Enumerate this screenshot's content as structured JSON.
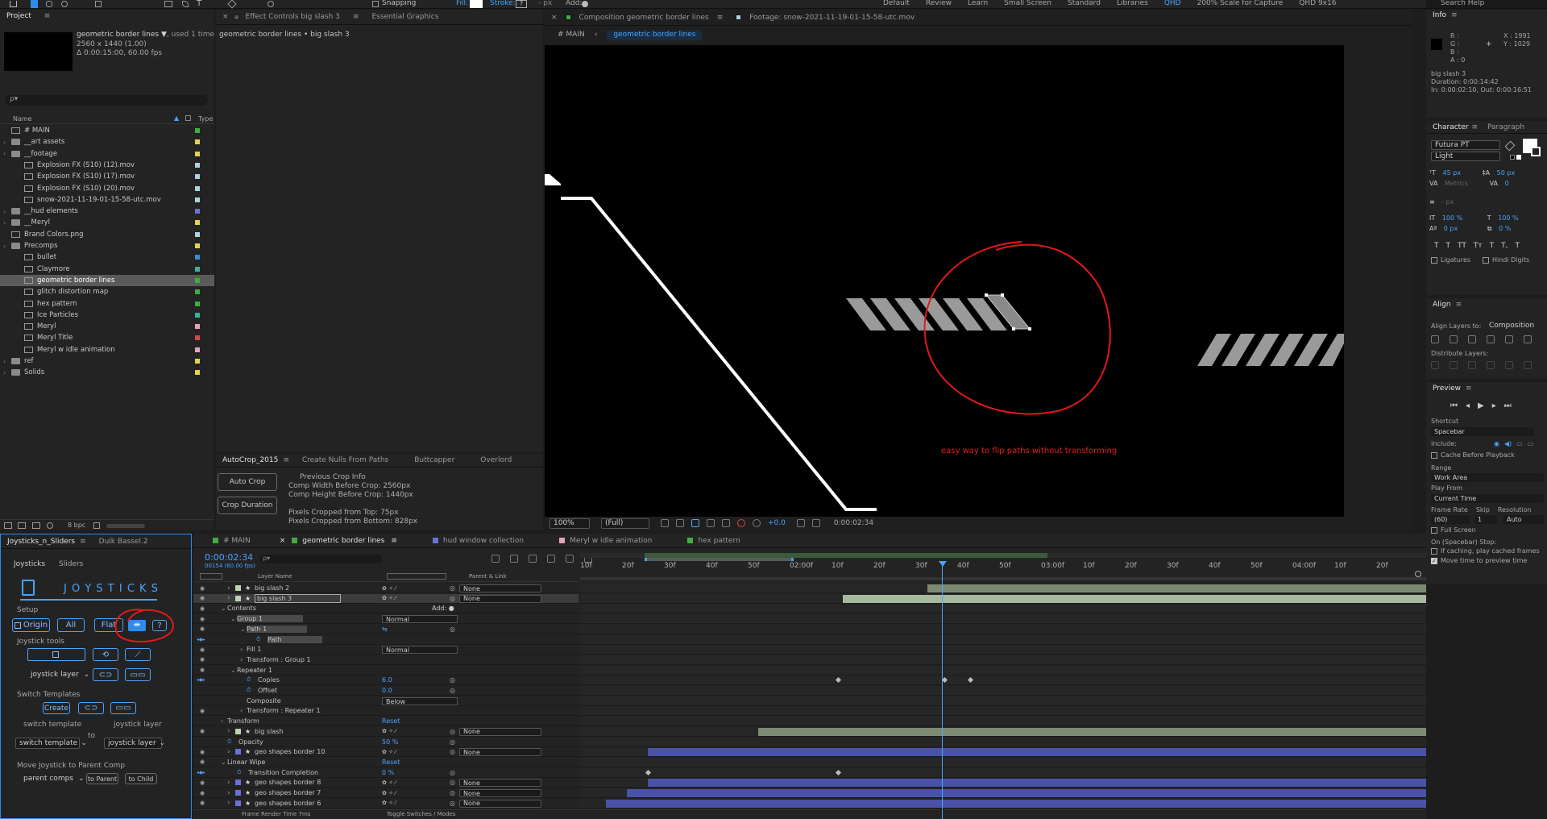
{
  "toolbar": {
    "snapping": "Snapping",
    "fill": "Fill:",
    "stroke": "Stroke:",
    "stroke_val": "?",
    "px": "- px",
    "add": "Add:",
    "workspaces": [
      "Default",
      "Review",
      "Learn",
      "Small Screen",
      "Standard",
      "Libraries",
      "QHD",
      "200% Scale for Capture",
      "QHD 9x16"
    ],
    "active_workspace": "QHD",
    "search": "Search Help"
  },
  "project": {
    "tab": "Project",
    "item_name": "geometric border lines ▼",
    "used": ", used 1 time",
    "dims": "2560 x 1440 (1.00)",
    "duration": "Δ 0:00:15:00, 60.00 fps",
    "search_placeholder": "ρ▾",
    "col_name": "Name",
    "col_type": "Type",
    "bpc": "8 bpc",
    "items": [
      {
        "name": "# MAIN",
        "indent": 0,
        "color": "#3fae3f",
        "sel": false
      },
      {
        "name": "__art assets",
        "indent": 0,
        "color": "#e4d44a",
        "sel": false
      },
      {
        "name": "__footage",
        "indent": 0,
        "color": "#e4d44a",
        "sel": false
      },
      {
        "name": "Explosion FX (S10) (12).mov",
        "indent": 2,
        "color": "#aad4e0",
        "sel": false
      },
      {
        "name": "Explosion FX (S10) (17).mov",
        "indent": 2,
        "color": "#aad4e0",
        "sel": false
      },
      {
        "name": "Explosion FX (S10) (20).mov",
        "indent": 2,
        "color": "#aad4e0",
        "sel": false
      },
      {
        "name": "snow-2021-11-19-01-15-58-utc.mov",
        "indent": 2,
        "color": "#aad4e0",
        "sel": false
      },
      {
        "name": "__hud elements",
        "indent": 0,
        "color": "#6a72d8",
        "sel": false
      },
      {
        "name": "__Meryl",
        "indent": 0,
        "color": "#e4d44a",
        "sel": false
      },
      {
        "name": "Brand Colors.png",
        "indent": 0,
        "color": "#aad4e0",
        "sel": false
      },
      {
        "name": "Precomps",
        "indent": 0,
        "color": "#e4d44a",
        "sel": false
      },
      {
        "name": "bullet",
        "indent": 2,
        "color": "#3a8ad0",
        "sel": false
      },
      {
        "name": "Claymore",
        "indent": 2,
        "color": "#3fae9f",
        "sel": false
      },
      {
        "name": "geometric border lines",
        "indent": 2,
        "color": "#3fae3f",
        "sel": true
      },
      {
        "name": "glitch distortion map",
        "indent": 2,
        "color": "#3fae3f",
        "sel": false
      },
      {
        "name": "hex pattern",
        "indent": 2,
        "color": "#3fae3f",
        "sel": false
      },
      {
        "name": "Ice Particles",
        "indent": 2,
        "color": "#3fae9f",
        "sel": false
      },
      {
        "name": "Meryl",
        "indent": 2,
        "color": "#e6a0b8",
        "sel": false
      },
      {
        "name": "Meryl Title",
        "indent": 2,
        "color": "#d04848",
        "sel": false
      },
      {
        "name": "Meryl w idle animation",
        "indent": 2,
        "color": "#e6a0b8",
        "sel": false
      },
      {
        "name": "ref",
        "indent": 0,
        "color": "#e4d44a",
        "sel": false
      },
      {
        "name": "Solids",
        "indent": 0,
        "color": "#e4d44a",
        "sel": false
      }
    ]
  },
  "effect": {
    "tab": "Effect Controls",
    "tab_layer": "big slash 3",
    "tab2": "Essential Graphics",
    "subtitle": "geometric border lines • big slash 3"
  },
  "autocrop": {
    "tabs": [
      "AutoCrop_2015",
      "Create Nulls From Paths",
      "Buttcapper",
      "Overlord"
    ],
    "auto_crop": "Auto Crop",
    "crop_duration": "Crop Duration",
    "info": [
      "Previous Crop Info",
      "Comp Width Before Crop: 2560px",
      "Comp Height Before Crop: 1440px",
      "",
      "Pixels Cropped from Top: 75px",
      "Pixels Cropped from Bottom: 828px"
    ]
  },
  "joysticks": {
    "tab": "Joysticks_n_Sliders",
    "tab2": "Duik Bassel.2",
    "subtab1": "Joysticks",
    "subtab2": "Sliders",
    "title": "J O Y S T I C K S",
    "setup": "Setup",
    "origin": "Origin",
    "all": "All",
    "flat": "Flat",
    "q": "?",
    "tools": "Joystick tools",
    "joystick_layer": "joystick layer",
    "switch_templates": "Switch Templates",
    "create": "Create",
    "switch_template": "switch template",
    "to": "to",
    "switch_template_dd": "switch template",
    "joystick_layer_dd": "joystick layer",
    "move": "Move Joystick to Parent Comp",
    "parent_comps": "parent comps",
    "to_parent": "to Parent",
    "to_child": "to Child"
  },
  "comp": {
    "tab": "Composition",
    "tab_name": "geometric border lines",
    "footage": "Footage: snow-2021-11-19-01-15-58-utc.mov",
    "crumb1": "# MAIN",
    "crumb2": "geometric border lines",
    "zoom": "100%",
    "quality": "(Full)",
    "exposure": "+0.0",
    "time": "0:00:02:34",
    "annotation": "easy way to flip paths without transforming"
  },
  "info": {
    "tab": "Info",
    "r": "R :",
    "g": "G :",
    "b": "B :",
    "a": "A : 0",
    "x": "X : 1991",
    "y": "Y : 1029",
    "layer": "big slash 3",
    "duration": "Duration: 0:00:14:42",
    "inout": "In: 0:00:02:10, Out: 0:00:16:51"
  },
  "character": {
    "tab": "Character",
    "tab2": "Paragraph",
    "font": "Futura PT",
    "style": "Light",
    "size": "45 px",
    "leading": "50 px",
    "kerning": "Metrics",
    "tracking": "0",
    "stroke_w": "- px",
    "vscale": "100 %",
    "hscale": "100 %",
    "baseline": "0 px",
    "tsume": "0 %",
    "caps": [
      "T",
      "T",
      "TT",
      "Tт",
      "T",
      "T,",
      "T"
    ],
    "ligatures": "Ligatures",
    "hindi": "Hindi Digits"
  },
  "align": {
    "tab": "Align",
    "label": "Align Layers to:",
    "value": "Composition",
    "distribute": "Distribute Layers:"
  },
  "preview": {
    "tab": "Preview",
    "shortcut": "Shortcut",
    "spacebar": "Spacebar",
    "include": "Include:",
    "cache": "Cache Before Playback",
    "range": "Range",
    "work_area": "Work Area",
    "play_from": "Play From",
    "current_time": "Current Time",
    "frame_rate": "Frame Rate",
    "skip": "Skip",
    "resolution": "Resolution",
    "fr_val": "(60)",
    "skip_val": "1",
    "res_val": "Auto",
    "full_screen": "Full Screen",
    "on_stop": "On (Spacebar) Stop:",
    "if_caching": "If caching, play cached frames",
    "move_time": "Move time to preview time"
  },
  "timeline": {
    "tabs": [
      "# MAIN",
      "geometric border lines",
      "hud window collection",
      "Meryl w idle animation",
      "hex pattern"
    ],
    "tab_colors": [
      "#3fae3f",
      "#3fae3f",
      "#6a72d8",
      "#e6a0b8",
      "#3fae3f"
    ],
    "active_tab": 1,
    "timecode": "0:00:02:34",
    "frames": "00154 (60.00 fps)",
    "col_layer": "Layer Name",
    "col_parent": "Parent & Link",
    "add": "Add:",
    "footer": "Frame Render Time  7ms",
    "footer2": "Toggle Switches / Modes",
    "ticks": [
      "10f",
      "20f",
      "30f",
      "40f",
      "50f",
      "02:00f",
      "10f",
      "20f",
      "30f",
      "40f",
      "50f",
      "03:00f",
      "10f",
      "20f",
      "30f",
      "40f",
      "50f",
      "04:00f",
      "10f",
      "20f"
    ],
    "rows": [
      {
        "type": "layer",
        "num": "",
        "name": "big slash 2",
        "color": "#b8d4b0",
        "parent": "None",
        "indent": 0,
        "bar": "#7c8a74",
        "bar_start": 0.41,
        "bar_end": 1.0
      },
      {
        "type": "layer",
        "num": "",
        "name": "big slash 3",
        "color": "#b8d4b0",
        "parent": "None",
        "indent": 0,
        "selected": true,
        "bar": "#a6b89e",
        "bar_start": 0.31,
        "bar_end": 1.0
      },
      {
        "type": "prop",
        "name": "Contents",
        "indent": 1,
        "value": "",
        "add": true
      },
      {
        "type": "prop",
        "name": "Group 1",
        "indent": 2,
        "value": "Normal",
        "dd": true,
        "sel": true
      },
      {
        "type": "prop",
        "name": "Path 1",
        "indent": 3,
        "value": "⇆",
        "sel": true
      },
      {
        "type": "prop",
        "name": "Path",
        "indent": 4,
        "value": "",
        "sel": true,
        "kf": true
      },
      {
        "type": "prop",
        "name": "Fill 1",
        "indent": 3,
        "value": "Normal",
        "dd": true
      },
      {
        "type": "prop",
        "name": "Transform : Group 1",
        "indent": 3,
        "value": ""
      },
      {
        "type": "prop",
        "name": "Repeater 1",
        "indent": 2,
        "value": ""
      },
      {
        "type": "prop",
        "name": "Copies",
        "indent": 3,
        "value": "6.0",
        "kf": true
      },
      {
        "type": "prop",
        "name": "Offset",
        "indent": 3,
        "value": "0.0"
      },
      {
        "type": "prop",
        "name": "Composite",
        "indent": 3,
        "value": "Below",
        "dd": true
      },
      {
        "type": "prop",
        "name": "Transform : Repeater 1",
        "indent": 3,
        "value": ""
      },
      {
        "type": "prop",
        "name": "Transform",
        "indent": 1,
        "value": "Reset"
      },
      {
        "type": "layer",
        "num": "",
        "name": "big slash",
        "color": "#b8d4b0",
        "parent": "None",
        "indent": 0,
        "bar": "#7c8a74",
        "bar_start": 0.21,
        "bar_end": 1.0
      },
      {
        "type": "prop",
        "name": "Opacity",
        "indent": 1,
        "value": "50 %"
      },
      {
        "type": "layer",
        "num": "",
        "name": "geo shapes border 10",
        "color": "#6a72d8",
        "parent": "None",
        "indent": 0,
        "bar": "#4a52a8",
        "bar_start": 0.08,
        "bar_end": 1.0
      },
      {
        "type": "prop",
        "name": "Linear Wipe",
        "indent": 1,
        "value": "Reset"
      },
      {
        "type": "prop",
        "name": "Transition Completion",
        "indent": 2,
        "value": "0 %",
        "kf": true
      },
      {
        "type": "layer",
        "num": "",
        "name": "geo shapes border 8",
        "color": "#6a72d8",
        "parent": "None",
        "indent": 0,
        "bar": "#4a52a8",
        "bar_start": 0.08,
        "bar_end": 1.0
      },
      {
        "type": "layer",
        "num": "",
        "name": "geo shapes border 7",
        "color": "#6a72d8",
        "parent": "None",
        "indent": 0,
        "bar": "#4a52a8",
        "bar_start": 0.055,
        "bar_end": 1.0
      },
      {
        "type": "layer",
        "num": "",
        "name": "geo shapes border 6",
        "color": "#6a72d8",
        "parent": "None",
        "indent": 0,
        "bar": "#4a52a8",
        "bar_start": 0.03,
        "bar_end": 1.0
      }
    ]
  }
}
